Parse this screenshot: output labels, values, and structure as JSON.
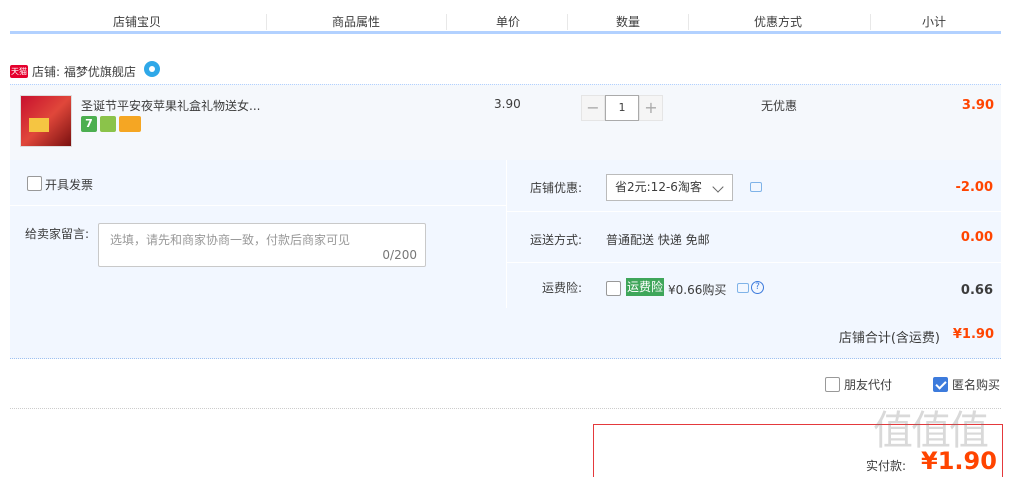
{
  "header": {
    "columns": [
      "店铺宝贝",
      "商品属性",
      "单价",
      "数量",
      "优惠方式",
      "小计"
    ]
  },
  "shop": {
    "badge": "天猫",
    "name": "店铺: 福梦优旗舰店"
  },
  "item": {
    "title": "圣诞节平安夜苹果礼盒礼物送女...",
    "price": "3.90",
    "quantity": "1",
    "qty_minus": "−",
    "qty_plus": "+",
    "promo": "无优惠",
    "subtotal": "3.90",
    "service_icons": [
      "seven-day-return-icon",
      "guarantee-icon",
      "card-icon"
    ],
    "service_badge_text": "7"
  },
  "invoice": {
    "label": "开具发票",
    "checked": false
  },
  "message": {
    "label": "给卖家留言:",
    "placeholder": "选填，请先和商家协商一致，付款后商家可见",
    "counter": "0/200"
  },
  "shop_discount": {
    "label": "店铺优惠:",
    "selected": "省2元:12-6淘客",
    "value": "-2.00"
  },
  "shipping": {
    "label": "运送方式:",
    "method": "普通配送 快递 免邮",
    "value": "0.00"
  },
  "insurance": {
    "label": "运费险:",
    "tag": "运费险",
    "price_text": "¥0.66购买",
    "value": "0.66",
    "checked": false
  },
  "shop_total": {
    "label": "店铺合计(含运费)",
    "value": "¥1.90"
  },
  "options": {
    "friend_pay": {
      "label": "朋友代付",
      "checked": false
    },
    "anonymous": {
      "label": "匿名购买",
      "checked": true
    }
  },
  "payment": {
    "label": "实付款:",
    "value": "¥1.90"
  },
  "watermark": "值值值",
  "colors": {
    "accent_price": "#ff4400",
    "panel_bg": "#f2f7ff",
    "header_line": "#b2d1ff",
    "checkbox_on": "#3d7bdc",
    "insurance_tag": "#3fa65a"
  }
}
